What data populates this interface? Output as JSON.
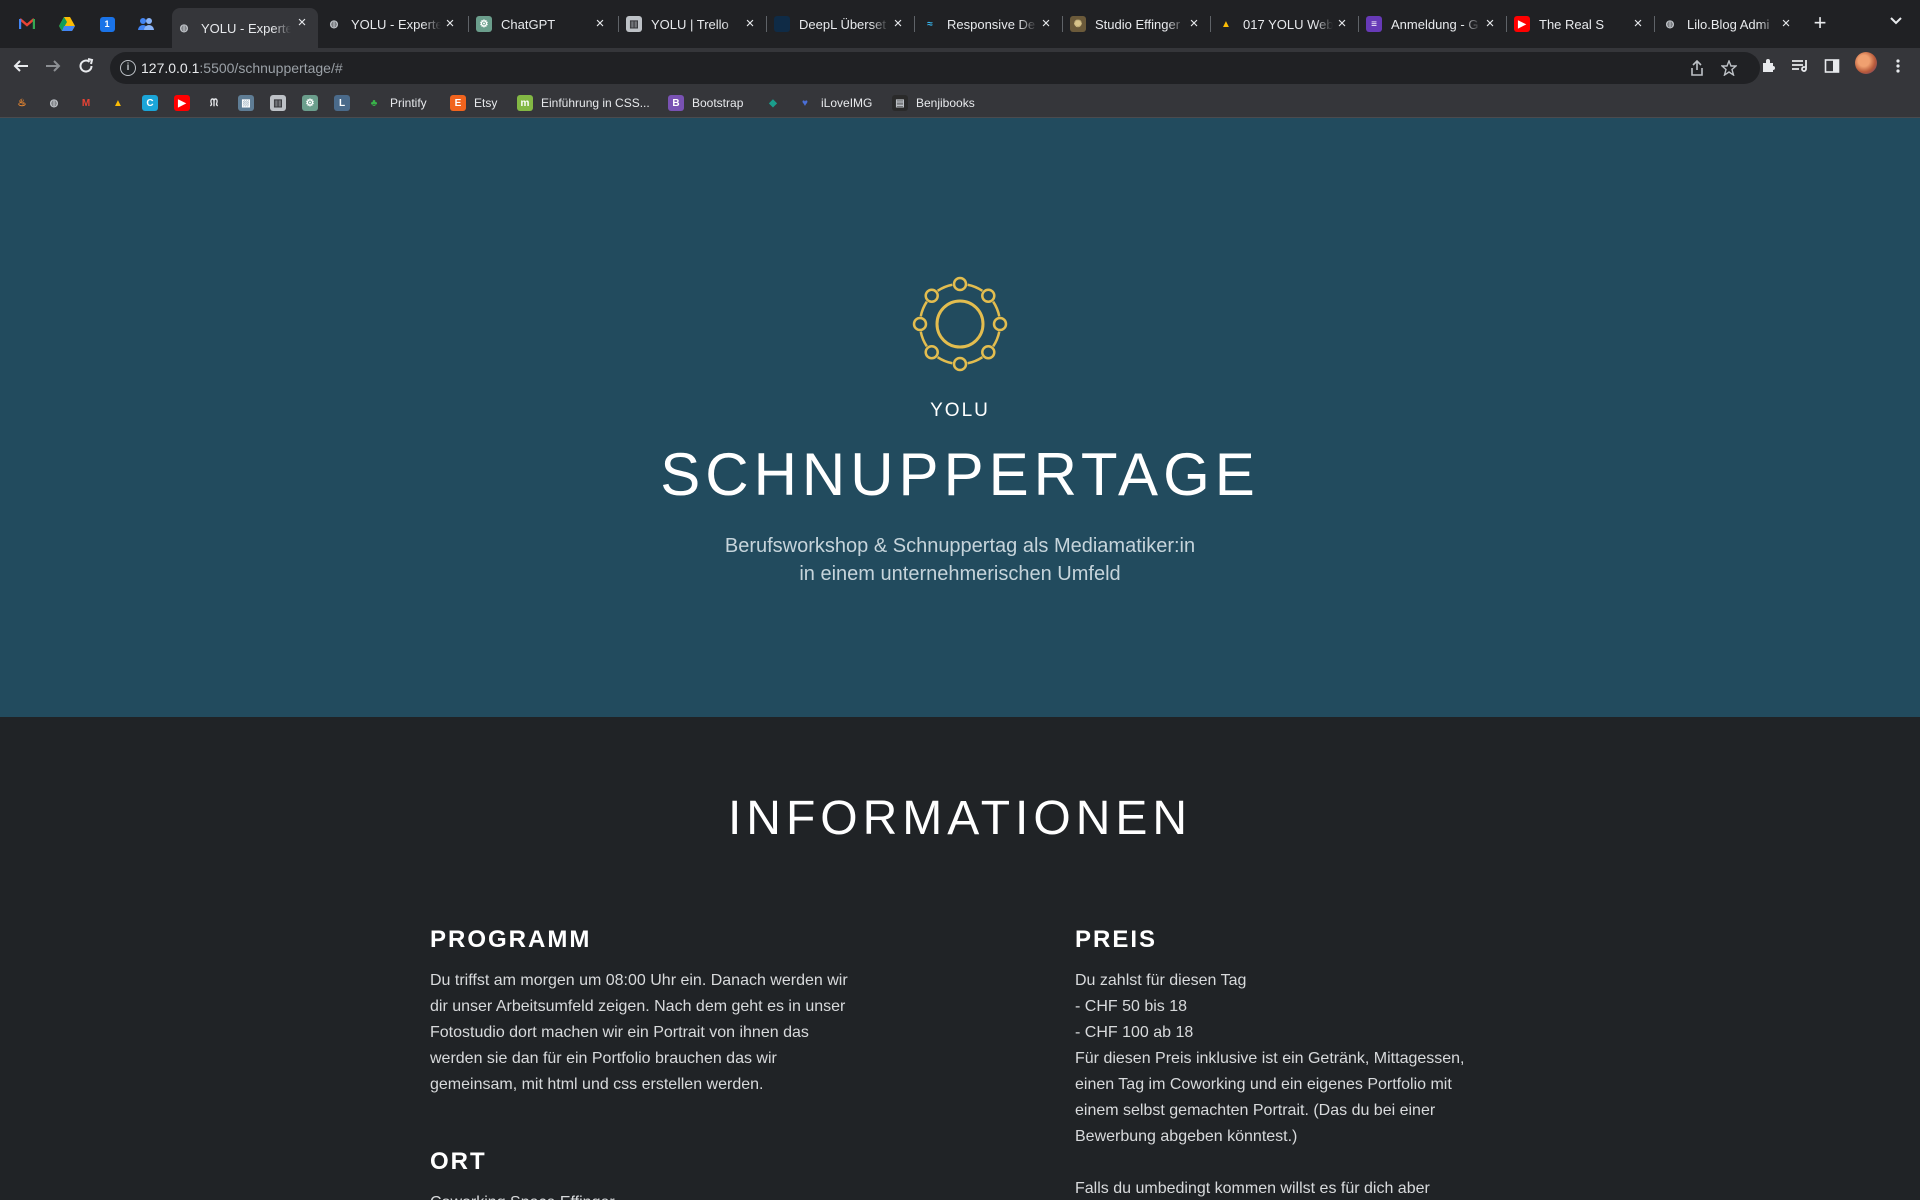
{
  "browser": {
    "pinned_tabs": [
      "gmail-icon",
      "drive-icon",
      "calendar-icon",
      "contacts-icon"
    ],
    "tabs": [
      {
        "title": "YOLU - Experte",
        "icon": "globe-icon",
        "active": true
      },
      {
        "title": "YOLU - Experte",
        "icon": "globe-icon"
      },
      {
        "title": "ChatGPT",
        "icon": "chatgpt-icon"
      },
      {
        "title": "YOLU | Trello",
        "icon": "trello-icon"
      },
      {
        "title": "DeepL Überset",
        "icon": "deepl-icon"
      },
      {
        "title": "Responsive De",
        "icon": "tailwind-icon"
      },
      {
        "title": "Studio Effinger",
        "icon": "studio-icon"
      },
      {
        "title": "017 YOLU Web",
        "icon": "drive-icon"
      },
      {
        "title": "Anmeldung - G",
        "icon": "forms-icon"
      },
      {
        "title": "The Real S",
        "icon": "youtube-icon"
      },
      {
        "title": "Lilo.Blog Admi",
        "icon": "globe-icon"
      }
    ],
    "url_host": "127.0.0.1",
    "url_rest": ":5500/schnuppertage/#",
    "bookmarks": [
      {
        "label": "",
        "icon": "flame-icon"
      },
      {
        "label": "",
        "icon": "globe-icon"
      },
      {
        "label": "",
        "icon": "gmail-icon"
      },
      {
        "label": "",
        "icon": "drive-icon"
      },
      {
        "label": "",
        "icon": "canva-icon"
      },
      {
        "label": "",
        "icon": "youtube-icon"
      },
      {
        "label": "",
        "icon": "notion-icon"
      },
      {
        "label": "",
        "icon": "image-icon"
      },
      {
        "label": "",
        "icon": "trello-icon"
      },
      {
        "label": "",
        "icon": "chatgpt-icon"
      },
      {
        "label": "",
        "icon": "lexicon-icon"
      },
      {
        "label": "Printify",
        "icon": "printify-icon"
      },
      {
        "label": "Etsy",
        "icon": "etsy-icon"
      },
      {
        "label": "Einführung in CSS...",
        "icon": "mdn-icon"
      },
      {
        "label": "Bootstrap",
        "icon": "bootstrap-icon"
      },
      {
        "label": "",
        "icon": "diamond-icon"
      },
      {
        "label": "iLoveIMG",
        "icon": "heart-icon"
      },
      {
        "label": "Benjibooks",
        "icon": "book-icon"
      }
    ]
  },
  "hero": {
    "brand": "YOLU",
    "title": "SCHNUPPERTAGE",
    "subtitle_line1": "Berufsworkshop & Schnuppertag als Mediamatiker:in",
    "subtitle_line2": "in einem unternehmerischen Umfeld"
  },
  "info": {
    "heading": "INFORMATIONEN",
    "programm": {
      "title": "PROGRAMM",
      "text": "Du triffst am morgen um 08:00 Uhr ein. Danach werden wir dir unser Arbeitsumfeld zeigen. Nach dem geht es in unser Fotostudio dort machen wir ein Portrait von ihnen das werden sie dan für ein Portfolio brauchen das wir gemeinsam, mit html und css erstellen werden."
    },
    "ort": {
      "title": "ORT",
      "text": "Coworking Space Effinger"
    },
    "preis": {
      "title": "PREIS",
      "line1": "Du zahlst für diesen Tag",
      "line2": "- CHF 50 bis 18",
      "line3": "- CHF 100 ab 18",
      "line4": "Für diesen Preis inklusive ist ein Getränk, Mittagessen, einen Tag im Coworking und ein eigenes Portfolio mit einem selbst gemachten Portrait. (Das du bei einer Bewerbung abgeben könntest.)",
      "line5": "Falls du umbedingt kommen willst es für dich aber"
    }
  },
  "colors": {
    "hero_bg": "#224b5e",
    "info_bg": "#202326",
    "logo_gold": "#e3bd4f"
  }
}
